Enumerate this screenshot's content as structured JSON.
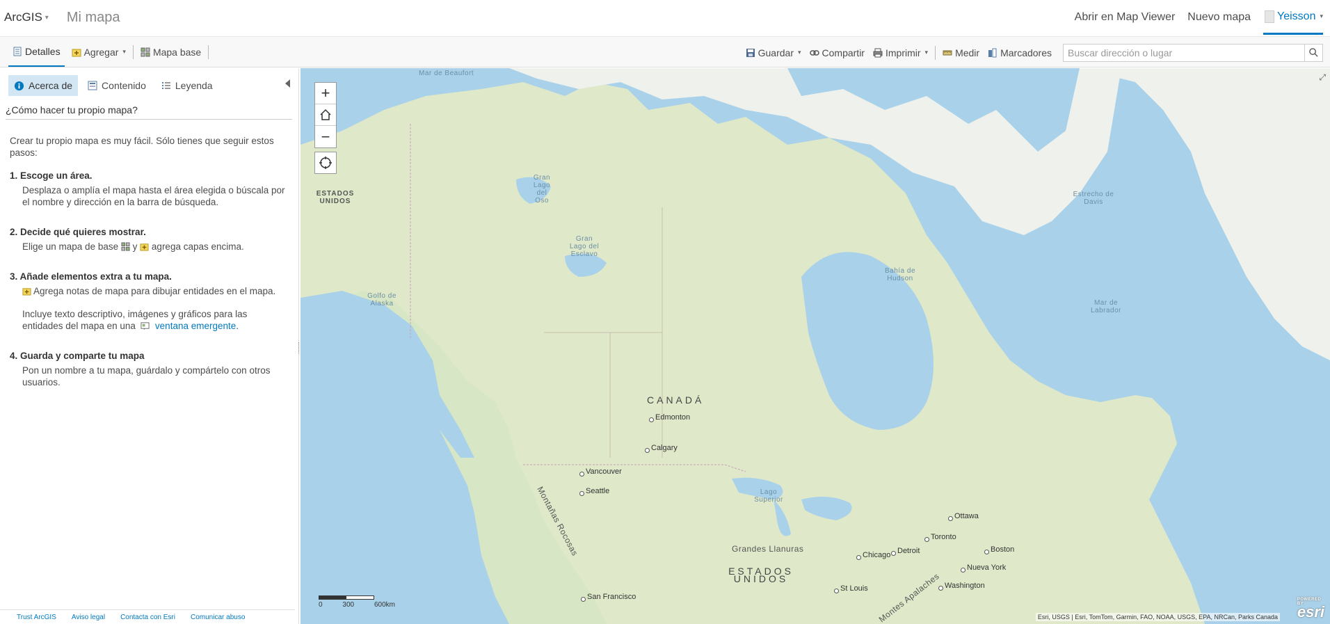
{
  "header": {
    "brand": "ArcGIS",
    "map_title": "Mi mapa",
    "open_map_viewer": "Abrir en Map Viewer",
    "new_map": "Nuevo mapa",
    "user": "Yeisson"
  },
  "toolbar": {
    "details": "Detalles",
    "add": "Agregar",
    "basemap": "Mapa base",
    "save": "Guardar",
    "share": "Compartir",
    "print": "Imprimir",
    "measure": "Medir",
    "bookmarks": "Marcadores",
    "search_placeholder": "Buscar dirección o lugar"
  },
  "panel": {
    "tabs": {
      "about": "Acerca de",
      "content": "Contenido",
      "legend": "Leyenda"
    },
    "heading": "¿Cómo hacer tu propio mapa?",
    "intro": "Crear tu propio mapa es muy fácil. Sólo tienes que seguir estos pasos:",
    "steps": [
      {
        "title": "1. Escoge un área.",
        "body": "Desplaza o amplía el mapa hasta el área elegida o búscala por el nombre y dirección en la barra de búsqueda."
      },
      {
        "title": "2. Decide qué quieres mostrar.",
        "body_a": "Elige un mapa de base",
        "body_b": "y",
        "body_c": "agrega capas encima."
      },
      {
        "title": "3. Añade elementos extra a tu mapa.",
        "body": "Agrega notas de mapa para dibujar entidades en el mapa.",
        "body2_a": "Incluye texto descriptivo, imágenes y gráficos para las entidades del mapa en una",
        "body2_link": "ventana emergente",
        "body2_end": "."
      },
      {
        "title": "4. Guarda y comparte tu mapa",
        "body": "Pon un nombre a tu mapa, guárdalo y compártelo con otros usuarios."
      }
    ],
    "footer": [
      "Trust ArcGIS",
      "Aviso legal",
      "Contacta con Esri",
      "Comunicar abuso"
    ]
  },
  "map": {
    "labels": {
      "beaufort": "Mar de Beaufort",
      "usa_nw": "ESTADOS UNIDOS",
      "great_bear": "Gran Lago del Oso",
      "great_slave": "Gran Lago del Esclavo",
      "davis": "Estrecho de Davis",
      "hudson": "Bahía de Hudson",
      "alaska_gulf": "Golfo de Alaska",
      "labrador": "Mar de Labrador",
      "canada": "CANADÁ",
      "rockies": "Montañas Rocosas",
      "superior": "Lago Superior",
      "plains": "Grandes Llanuras",
      "usa": "ESTADOS UNIDOS",
      "appalachians": "Montes Apalaches"
    },
    "cities": {
      "edmonton": "Edmonton",
      "calgary": "Calgary",
      "vancouver": "Vancouver",
      "seattle": "Seattle",
      "ottawa": "Ottawa",
      "toronto": "Toronto",
      "boston": "Boston",
      "chicago": "Chicago",
      "detroit": "Detroit",
      "new_york": "Nueva York",
      "washington": "Washington",
      "st_louis": "St Louis",
      "san_francisco": "San Francisco"
    },
    "scale": [
      "0",
      "300",
      "600km"
    ],
    "attribution": "Esri, USGS | Esri, TomTom, Garmin, FAO, NOAA, USGS, EPA, NRCan, Parks Canada",
    "esri_logo": "esri",
    "powered_by": "POWERED BY"
  }
}
